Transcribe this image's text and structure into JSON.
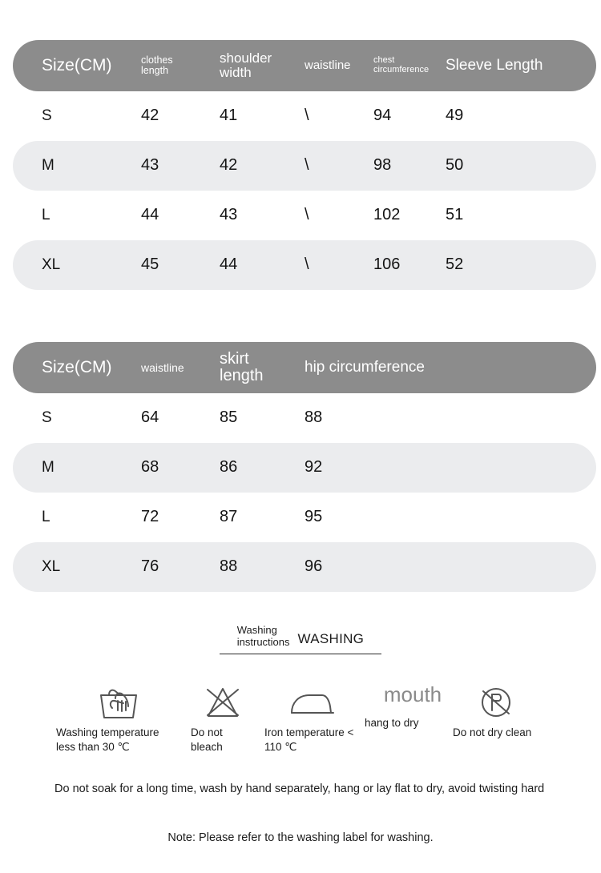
{
  "tables": [
    {
      "id": "top",
      "headers": [
        "Size(CM)",
        "clothes\nlength",
        "shoulder\nwidth",
        "waistline",
        "chest\ncircumference",
        "Sleeve Length"
      ],
      "rows": [
        [
          "S",
          "42",
          "41",
          "\\",
          "94",
          "49"
        ],
        [
          "M",
          "43",
          "42",
          "\\",
          "98",
          "50"
        ],
        [
          "L",
          "44",
          "43",
          "\\",
          "102",
          "51"
        ],
        [
          "XL",
          "45",
          "44",
          "\\",
          "106",
          "52"
        ]
      ]
    },
    {
      "id": "bottom",
      "headers": [
        "Size(CM)",
        "waistline",
        "skirt\nlength",
        "hip circumference"
      ],
      "rows": [
        [
          "S",
          "64",
          "85",
          "88"
        ],
        [
          "M",
          "68",
          "86",
          "92"
        ],
        [
          "L",
          "72",
          "87",
          "95"
        ],
        [
          "XL",
          "76",
          "88",
          "96"
        ]
      ]
    }
  ],
  "washing": {
    "title_cn": "Washing\ninstructions",
    "title_en": "WASHING",
    "icons": [
      {
        "icon": "hand-wash-icon",
        "label": "Washing temperature\nless than 30 ℃"
      },
      {
        "icon": "do-not-bleach-icon",
        "label": "Do not\nbleach"
      },
      {
        "icon": "iron-icon",
        "label": "Iron temperature <\n110 ℃"
      },
      {
        "icon": "hang-to-dry-icon",
        "label": "hang to dry",
        "word": "mouth"
      },
      {
        "icon": "do-not-dry-clean-icon",
        "label": "Do not dry clean"
      }
    ],
    "note_long": "Do not soak for a long time, wash by hand separately, hang or lay flat to dry, avoid twisting hard",
    "note_short": "Note: Please refer to the washing label for washing."
  },
  "colors": {
    "header_bg": "#8c8c8c",
    "alt_row_bg": "#ebecee",
    "text": "#1c1c1c",
    "icon_stroke": "#555555",
    "muted": "#8a8a8a"
  }
}
